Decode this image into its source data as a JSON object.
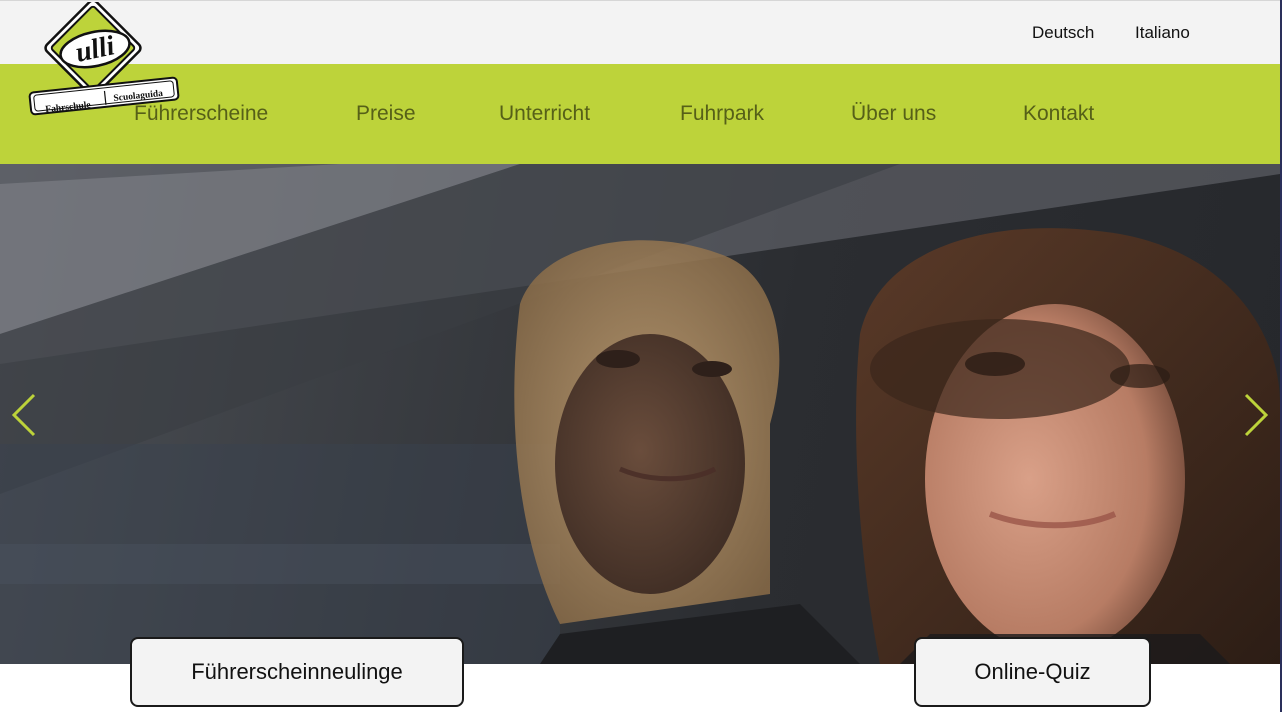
{
  "logo": {
    "wordmark": "ulli",
    "tagline_left": "Fahrschule",
    "tagline_right": "Scuolaguida"
  },
  "language": {
    "items": [
      "Deutsch",
      "Italiano"
    ]
  },
  "nav": {
    "items": [
      "Führerscheine",
      "Preise",
      "Unterricht",
      "Fuhrpark",
      "Über uns",
      "Kontakt"
    ]
  },
  "hero": {
    "arrow_color": "#bdd33a",
    "prev_icon": "chevron-left-icon",
    "next_icon": "chevron-right-icon"
  },
  "cta": {
    "primary": "Führerscheinneulinge",
    "secondary": "Online-Quiz"
  },
  "colors": {
    "brand_green": "#bdd33a",
    "nav_text": "#566018",
    "topbar_bg": "#f3f3f3"
  }
}
